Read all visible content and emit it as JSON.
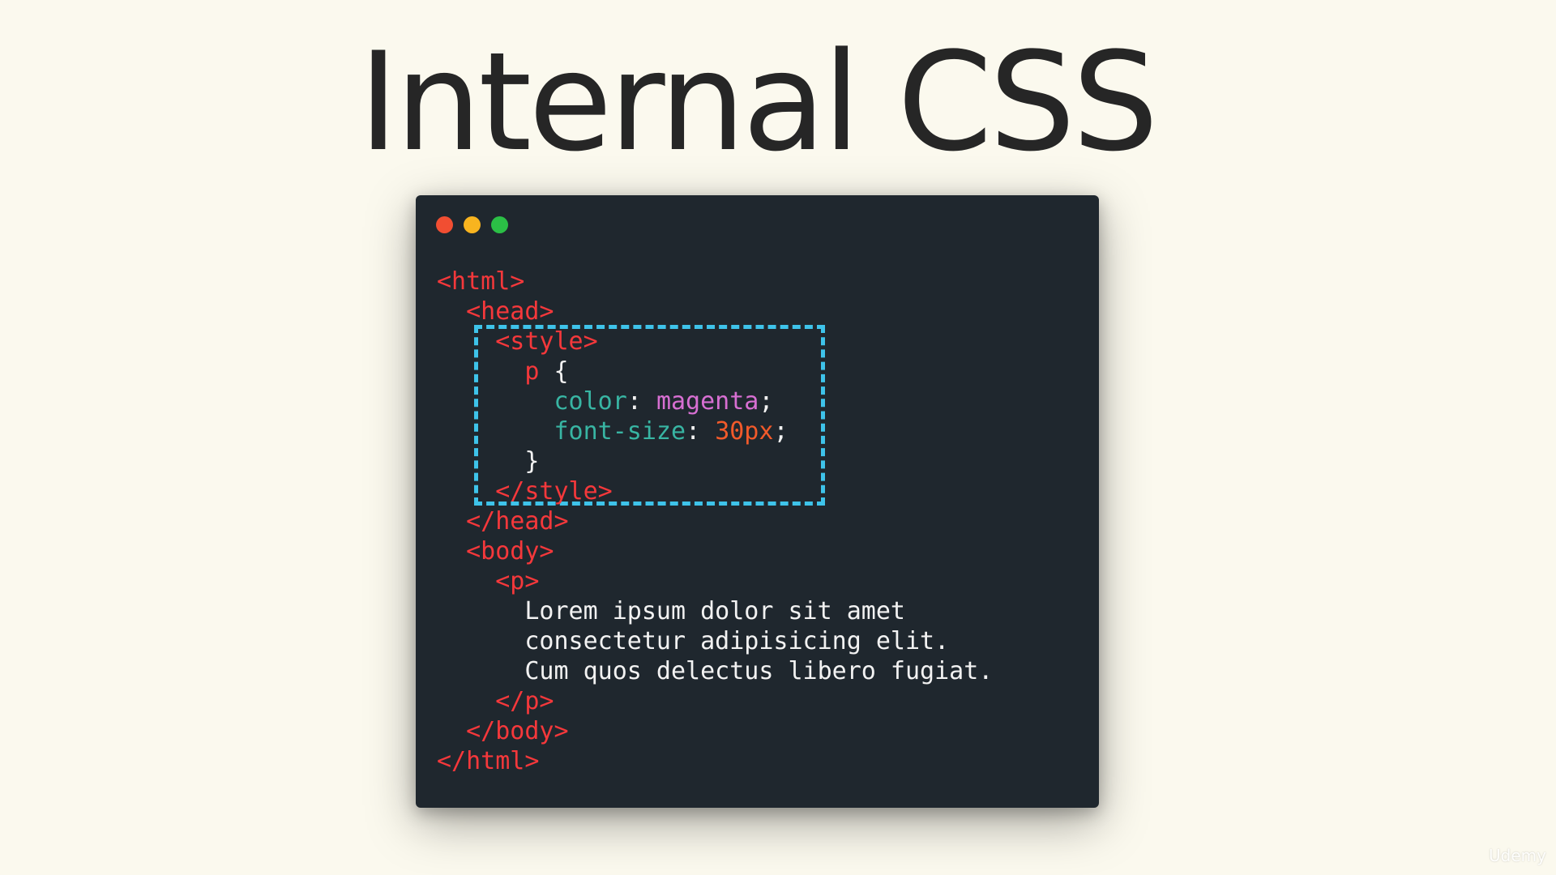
{
  "slide": {
    "title": "Internal CSS",
    "watermark": "Udemy"
  },
  "window": {
    "controls": [
      {
        "name": "close",
        "color": "#f14e32"
      },
      {
        "name": "minimize",
        "color": "#f8b41f"
      },
      {
        "name": "maximize",
        "color": "#2bbf46"
      }
    ]
  },
  "colors": {
    "tag": "#f5383b",
    "property": "#38b5a3",
    "keyword_value": "#d76fd2",
    "number": "#f25a2a",
    "text": "#f2f2f2",
    "highlight": "#3ec3ea",
    "editor_bg": "#1f272e",
    "page_bg": "#fbf9ee"
  },
  "code": {
    "highlighted_lines": [
      2,
      7
    ],
    "lines": [
      [
        {
          "t": "tag",
          "v": "<html>"
        }
      ],
      [
        {
          "t": "plain",
          "v": "  "
        },
        {
          "t": "tag",
          "v": "<head>"
        }
      ],
      [
        {
          "t": "plain",
          "v": "    "
        },
        {
          "t": "tag",
          "v": "<style>"
        }
      ],
      [
        {
          "t": "plain",
          "v": "      "
        },
        {
          "t": "tag",
          "v": "p"
        },
        {
          "t": "plain",
          "v": " {"
        }
      ],
      [
        {
          "t": "plain",
          "v": "        "
        },
        {
          "t": "prop",
          "v": "color"
        },
        {
          "t": "plain",
          "v": ": "
        },
        {
          "t": "str",
          "v": "magenta"
        },
        {
          "t": "plain",
          "v": ";"
        }
      ],
      [
        {
          "t": "plain",
          "v": "        "
        },
        {
          "t": "prop",
          "v": "font-size"
        },
        {
          "t": "plain",
          "v": ": "
        },
        {
          "t": "num",
          "v": "30px"
        },
        {
          "t": "plain",
          "v": ";"
        }
      ],
      [
        {
          "t": "plain",
          "v": "      }"
        }
      ],
      [
        {
          "t": "plain",
          "v": "    "
        },
        {
          "t": "tag",
          "v": "</style>"
        }
      ],
      [
        {
          "t": "plain",
          "v": "  "
        },
        {
          "t": "tag",
          "v": "</head>"
        }
      ],
      [
        {
          "t": "plain",
          "v": "  "
        },
        {
          "t": "tag",
          "v": "<body>"
        }
      ],
      [
        {
          "t": "plain",
          "v": "    "
        },
        {
          "t": "tag",
          "v": "<p>"
        }
      ],
      [
        {
          "t": "plain",
          "v": "      Lorem ipsum dolor sit amet"
        }
      ],
      [
        {
          "t": "plain",
          "v": "      consectetur adipisicing elit."
        }
      ],
      [
        {
          "t": "plain",
          "v": "      Cum quos delectus libero fugiat."
        }
      ],
      [
        {
          "t": "plain",
          "v": "    "
        },
        {
          "t": "tag",
          "v": "</p>"
        }
      ],
      [
        {
          "t": "plain",
          "v": "  "
        },
        {
          "t": "tag",
          "v": "</body>"
        }
      ],
      [
        {
          "t": "tag",
          "v": "</html>"
        }
      ]
    ]
  }
}
